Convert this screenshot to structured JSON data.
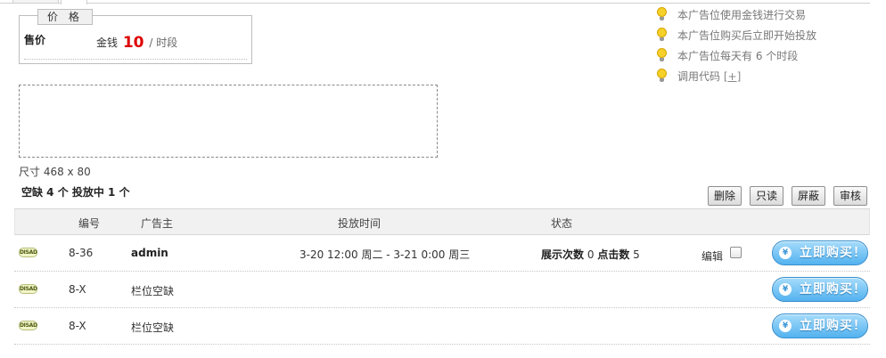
{
  "price": {
    "legend": "价 格",
    "label": "售价",
    "currency": "金钱",
    "amount": "10",
    "per_unit": "/ 时段"
  },
  "tips": [
    "本广告位使用金钱进行交易",
    "本广告位购买后立即开始投放",
    "本广告位每天有 6 个时段",
    "调用代码"
  ],
  "code_toggle": "[+]",
  "ad_size": "尺寸 468 x 80",
  "summary": "空缺 4 个  投放中 1 个",
  "actions": {
    "delete": "删除",
    "readonly": "只读",
    "hide": "屏蔽",
    "review": "审核"
  },
  "table": {
    "headers": {
      "id": "编号",
      "advertiser": "广告主",
      "time": "投放时间",
      "status": "状态"
    },
    "rows": [
      {
        "badge": "DISAD",
        "id": "8-36",
        "advertiser": "admin",
        "time": "3-20 12:00 周二 - 3-21 0:00 周三",
        "views_label": "展示次数",
        "views": "0",
        "clicks_label": "点击数",
        "clicks": "5",
        "edit": "编辑",
        "buy": "立即购买！"
      },
      {
        "badge": "DISAD",
        "id": "8-X",
        "advertiser": "栏位空缺",
        "buy": "立即购买！"
      },
      {
        "badge": "DISAD",
        "id": "8-X",
        "advertiser": "栏位空缺",
        "buy": "立即购买！"
      }
    ]
  },
  "colors": {
    "price_amount": "#dd0000",
    "buy_button": "#53b2ef",
    "tip_bulb": "#f6d12a"
  },
  "icons": {
    "tip": "lightbulb-icon",
    "badge": "disad-badge-icon",
    "buy": "yen-coin-icon"
  }
}
